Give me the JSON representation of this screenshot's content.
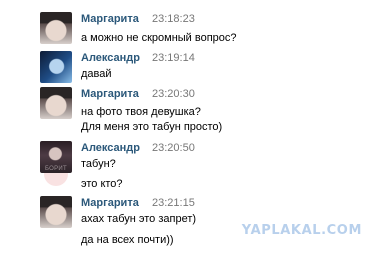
{
  "messages": [
    {
      "name": "Маргарита",
      "time": "23:18:23",
      "avatar": "user-avatar-photo",
      "lines": [
        "а можно не скромный вопрос?"
      ]
    },
    {
      "name": "Александр",
      "time": "23:19:14",
      "avatar": "user-avatar-photo",
      "lines": [
        "давай"
      ]
    },
    {
      "name": "Маргарита",
      "time": "23:20:30",
      "avatar": "user-avatar-photo",
      "lines": [
        "на фото твоя девушка?",
        "Для меня это табун просто)"
      ]
    },
    {
      "name": "Александр",
      "time": "23:20:50",
      "avatar": "user-avatar-photo",
      "avatar_caption": "БОРИТ",
      "lines": [
        "табун?",
        "это кто?"
      ]
    },
    {
      "name": "Маргарита",
      "time": "23:21:15",
      "avatar": "user-avatar-photo",
      "lines": [
        "ахах табун это запрет)",
        "да на всех почти))"
      ]
    }
  ],
  "watermark": "YAPLAKAL.COM",
  "colors": {
    "name": "#2b587a",
    "time": "#777777",
    "text": "#000000",
    "watermark": "#b8d0ec"
  }
}
